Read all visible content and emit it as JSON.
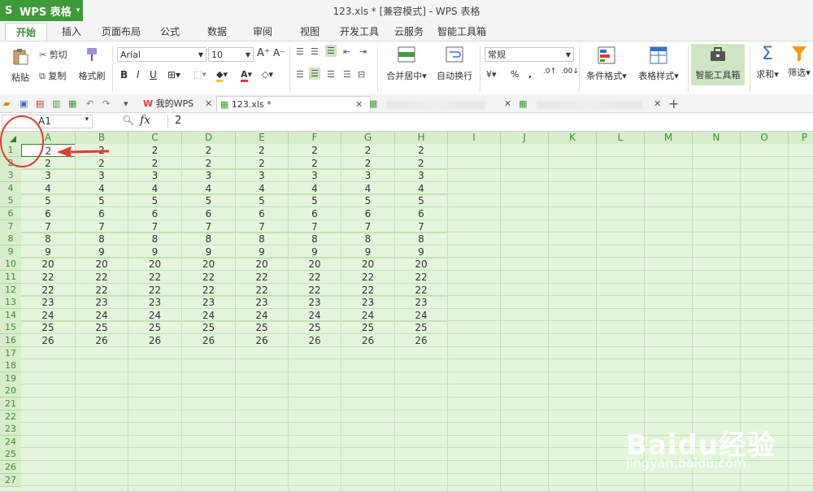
{
  "app": {
    "name": "WPS 表格",
    "window_title": "123.xls * [兼容模式] - WPS 表格"
  },
  "ribbon_tabs": [
    "开始",
    "插入",
    "页面布局",
    "公式",
    "数据",
    "审阅",
    "视图",
    "开发工具",
    "云服务",
    "智能工具箱"
  ],
  "ribbon": {
    "cut": "剪切",
    "copy": "复制",
    "paste": "粘贴",
    "format_painter": "格式刷",
    "font_name": "Arial",
    "font_size": "10",
    "merge_center": "合并居中",
    "wrap_text": "自动换行",
    "number_format": "常规",
    "percent": "%",
    "comma": ",",
    "conditional_format": "条件格式",
    "table_style": "表格样式",
    "smart_toolbox": "智能工具箱",
    "sum": "求和",
    "filter": "筛选"
  },
  "doc_tabs": [
    {
      "label": "我的WPS"
    },
    {
      "label": "123.xls *"
    }
  ],
  "formula_bar": {
    "cell_ref": "A1",
    "fx_label": "fx",
    "value": "2"
  },
  "grid": {
    "columns": [
      "A",
      "B",
      "C",
      "D",
      "E",
      "F",
      "G",
      "H",
      "I",
      "J",
      "K",
      "L",
      "M",
      "N",
      "O",
      "P"
    ],
    "rows": [
      1,
      2,
      3,
      4,
      5,
      6,
      7,
      8,
      9,
      10,
      11,
      12,
      13,
      14,
      15,
      16,
      17,
      18,
      19,
      20,
      21,
      22,
      23,
      24,
      25,
      26,
      27
    ],
    "data": [
      [
        "2",
        "2",
        "2",
        "2",
        "2",
        "2",
        "2",
        "2"
      ],
      [
        "2",
        "2",
        "2",
        "2",
        "2",
        "2",
        "2",
        "2"
      ],
      [
        "3",
        "3",
        "3",
        "3",
        "3",
        "3",
        "3",
        "3"
      ],
      [
        "4",
        "4",
        "4",
        "4",
        "4",
        "4",
        "4",
        "4"
      ],
      [
        "5",
        "5",
        "5",
        "5",
        "5",
        "5",
        "5",
        "5"
      ],
      [
        "6",
        "6",
        "6",
        "6",
        "6",
        "6",
        "6",
        "6"
      ],
      [
        "7",
        "7",
        "7",
        "7",
        "7",
        "7",
        "7",
        "7"
      ],
      [
        "8",
        "8",
        "8",
        "8",
        "8",
        "8",
        "8",
        "8"
      ],
      [
        "9",
        "9",
        "9",
        "9",
        "9",
        "9",
        "9",
        "9"
      ],
      [
        "20",
        "20",
        "20",
        "20",
        "20",
        "20",
        "20",
        "20"
      ],
      [
        "22",
        "22",
        "22",
        "22",
        "22",
        "22",
        "22",
        "22"
      ],
      [
        "22",
        "22",
        "22",
        "22",
        "22",
        "22",
        "22",
        "22"
      ],
      [
        "23",
        "23",
        "23",
        "23",
        "23",
        "23",
        "23",
        "23"
      ],
      [
        "24",
        "24",
        "24",
        "24",
        "24",
        "24",
        "24",
        "24"
      ],
      [
        "25",
        "25",
        "25",
        "25",
        "25",
        "25",
        "25",
        "25"
      ],
      [
        "26",
        "26",
        "26",
        "26",
        "26",
        "26",
        "26",
        "26"
      ]
    ]
  },
  "watermark": {
    "brand": "Baidu经验",
    "url": "jingyan.baidu.com"
  },
  "colors": {
    "brand_green": "#3f9b3a",
    "grid_bg": "#e4f5dc",
    "annotation_red": "#e53935"
  }
}
